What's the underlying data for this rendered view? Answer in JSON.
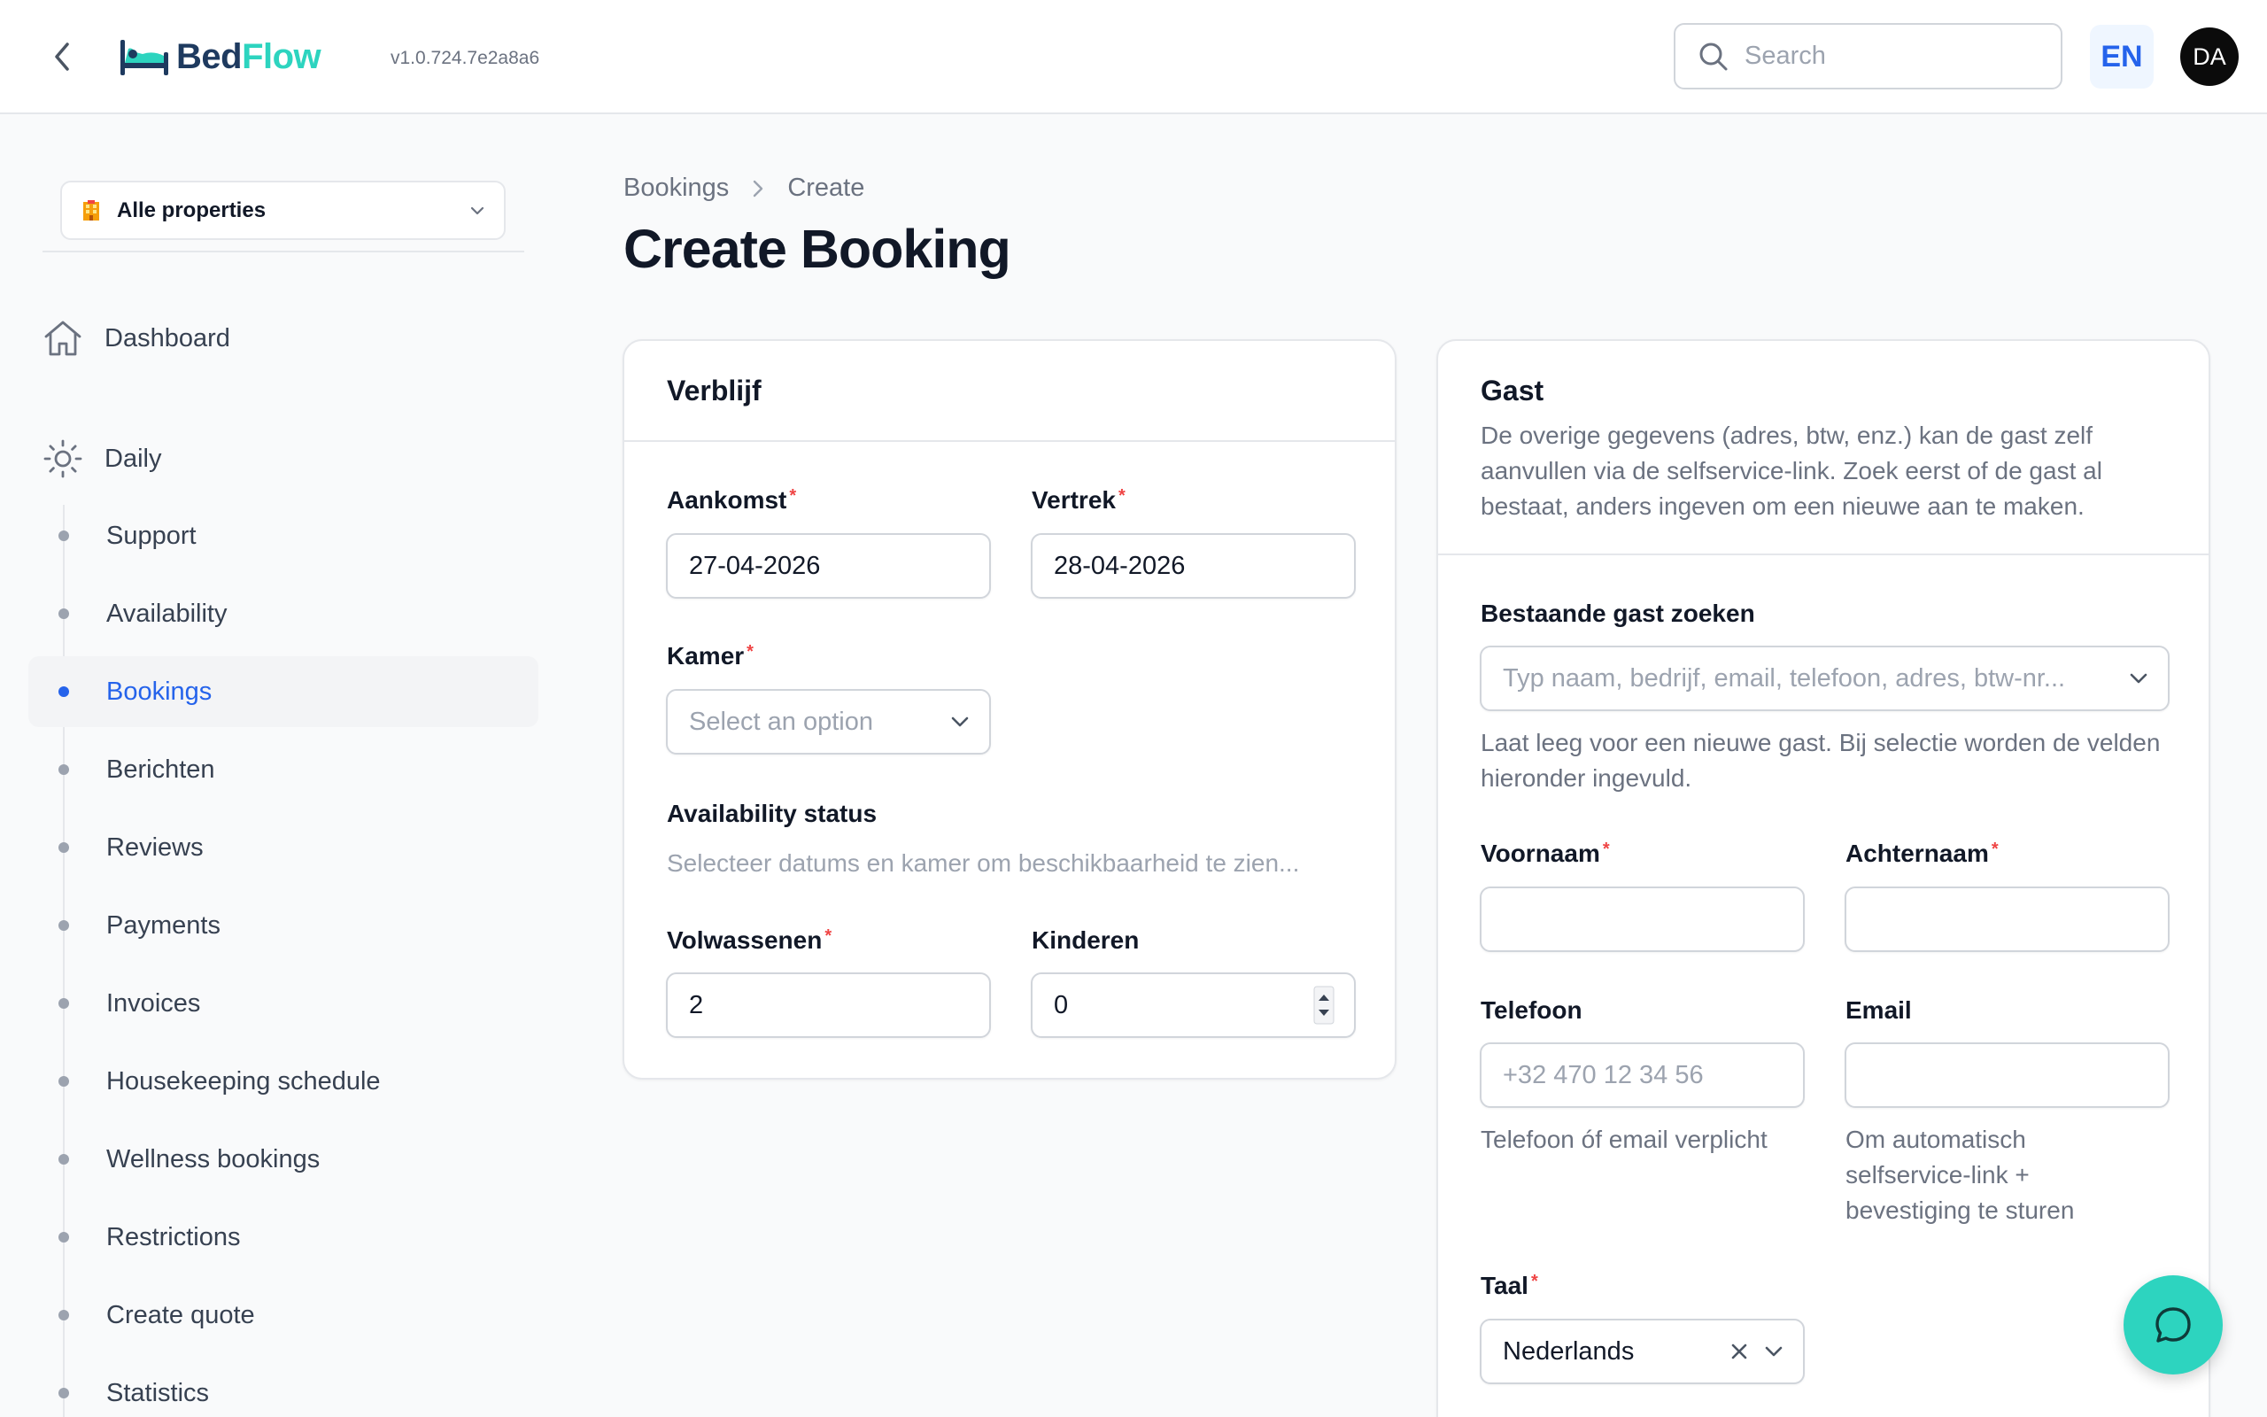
{
  "header": {
    "logo_bed": "Bed",
    "logo_flow": "Flow",
    "version": "v1.0.724.7e2a8a6",
    "search_placeholder": "Search",
    "language": "EN",
    "avatar_initials": "DA"
  },
  "sidebar": {
    "property_selector": "Alle properties",
    "dashboard": "Dashboard",
    "daily": "Daily",
    "items": [
      {
        "label": "Support",
        "active": false
      },
      {
        "label": "Availability",
        "active": false
      },
      {
        "label": "Bookings",
        "active": true
      },
      {
        "label": "Berichten",
        "active": false
      },
      {
        "label": "Reviews",
        "active": false
      },
      {
        "label": "Payments",
        "active": false
      },
      {
        "label": "Invoices",
        "active": false
      },
      {
        "label": "Housekeeping schedule",
        "active": false
      },
      {
        "label": "Wellness bookings",
        "active": false
      },
      {
        "label": "Restrictions",
        "active": false
      },
      {
        "label": "Create quote",
        "active": false
      },
      {
        "label": "Statistics",
        "active": false
      }
    ]
  },
  "breadcrumb": [
    "Bookings",
    "Create"
  ],
  "page_title": "Create Booking",
  "stay": {
    "title": "Verblijf",
    "arrival_label": "Aankomst",
    "arrival_value": "27-04-2026",
    "departure_label": "Vertrek",
    "departure_value": "28-04-2026",
    "room_label": "Kamer",
    "room_placeholder": "Select an option",
    "availability_label": "Availability status",
    "availability_text": "Selecteer datums en kamer om beschikbaarheid te zien...",
    "adults_label": "Volwassenen",
    "adults_value": "2",
    "children_label": "Kinderen",
    "children_value": "0"
  },
  "guest": {
    "title": "Gast",
    "description": "De overige gegevens (adres, btw, enz.) kan de gast zelf aanvullen via de selfservice-link. Zoek eerst of de gast al bestaat, anders ingeven om een nieuwe aan te maken.",
    "search_label": "Bestaande gast zoeken",
    "search_placeholder": "Typ naam, bedrijf, email, telefoon, adres, btw-nr...",
    "search_help": "Laat leeg voor een nieuwe gast. Bij selectie worden de velden hieronder ingevuld.",
    "first_name_label": "Voornaam",
    "last_name_label": "Achternaam",
    "phone_label": "Telefoon",
    "phone_placeholder": "+32 470 12 34 56",
    "phone_help": "Telefoon óf email verplicht",
    "email_label": "Email",
    "email_help": "Om automatisch selfservice-link + bevestiging te sturen",
    "language_label": "Taal",
    "language_value": "Nederlands"
  },
  "colors": {
    "accent": "#2563eb",
    "brand_teal": "#2dd4bf",
    "brand_navy": "#1e3a5f",
    "required": "#ef4444"
  }
}
